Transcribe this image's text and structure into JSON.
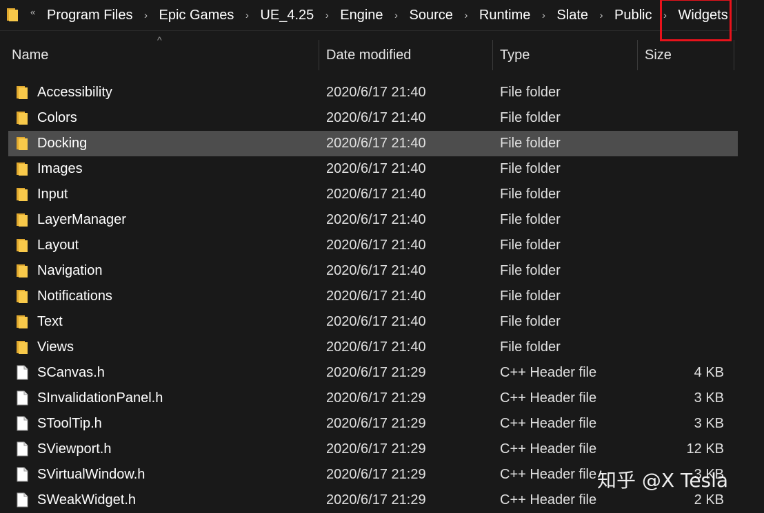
{
  "address_bar": {
    "overflow_glyph": "«",
    "separator_glyph": "›",
    "crumbs": [
      "Program Files",
      "Epic Games",
      "UE_4.25",
      "Engine",
      "Source",
      "Runtime",
      "Slate",
      "Public",
      "Widgets"
    ]
  },
  "columns": {
    "sort_glyph": "^",
    "name": "Name",
    "date": "Date modified",
    "type": "Type",
    "size": "Size"
  },
  "files": [
    {
      "name": "Accessibility",
      "date": "2020/6/17 21:40",
      "type": "File folder",
      "size": "",
      "kind": "folder"
    },
    {
      "name": "Colors",
      "date": "2020/6/17 21:40",
      "type": "File folder",
      "size": "",
      "kind": "folder"
    },
    {
      "name": "Docking",
      "date": "2020/6/17 21:40",
      "type": "File folder",
      "size": "",
      "kind": "folder",
      "selected": true
    },
    {
      "name": "Images",
      "date": "2020/6/17 21:40",
      "type": "File folder",
      "size": "",
      "kind": "folder"
    },
    {
      "name": "Input",
      "date": "2020/6/17 21:40",
      "type": "File folder",
      "size": "",
      "kind": "folder"
    },
    {
      "name": "LayerManager",
      "date": "2020/6/17 21:40",
      "type": "File folder",
      "size": "",
      "kind": "folder"
    },
    {
      "name": "Layout",
      "date": "2020/6/17 21:40",
      "type": "File folder",
      "size": "",
      "kind": "folder"
    },
    {
      "name": "Navigation",
      "date": "2020/6/17 21:40",
      "type": "File folder",
      "size": "",
      "kind": "folder"
    },
    {
      "name": "Notifications",
      "date": "2020/6/17 21:40",
      "type": "File folder",
      "size": "",
      "kind": "folder"
    },
    {
      "name": "Text",
      "date": "2020/6/17 21:40",
      "type": "File folder",
      "size": "",
      "kind": "folder"
    },
    {
      "name": "Views",
      "date": "2020/6/17 21:40",
      "type": "File folder",
      "size": "",
      "kind": "folder"
    },
    {
      "name": "SCanvas.h",
      "date": "2020/6/17 21:29",
      "type": "C++ Header file",
      "size": "4 KB",
      "kind": "file"
    },
    {
      "name": "SInvalidationPanel.h",
      "date": "2020/6/17 21:29",
      "type": "C++ Header file",
      "size": "3 KB",
      "kind": "file"
    },
    {
      "name": "SToolTip.h",
      "date": "2020/6/17 21:29",
      "type": "C++ Header file",
      "size": "3 KB",
      "kind": "file"
    },
    {
      "name": "SViewport.h",
      "date": "2020/6/17 21:29",
      "type": "C++ Header file",
      "size": "12 KB",
      "kind": "file"
    },
    {
      "name": "SVirtualWindow.h",
      "date": "2020/6/17 21:29",
      "type": "C++ Header file",
      "size": "3 KB",
      "kind": "file"
    },
    {
      "name": "SWeakWidget.h",
      "date": "2020/6/17 21:29",
      "type": "C++ Header file",
      "size": "2 KB",
      "kind": "file"
    }
  ],
  "watermark": "知乎 @X Tesla",
  "colors": {
    "background": "#191919",
    "selected_row": "#4d4d4d",
    "folder": "#f8c94a",
    "highlight_box": "#e8121b"
  },
  "icons": {
    "folder": "folder-icon",
    "file": "file-icon"
  }
}
